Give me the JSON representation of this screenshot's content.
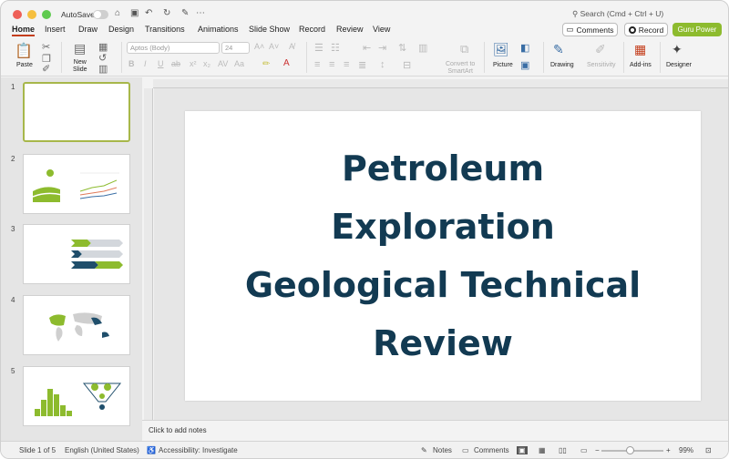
{
  "titlebar": {
    "autosave_label": "AutoSave",
    "search_placeholder": "Search (Cmd + Ctrl + U)"
  },
  "tabs": [
    {
      "label": "Home",
      "active": true
    },
    {
      "label": "Insert"
    },
    {
      "label": "Draw"
    },
    {
      "label": "Design"
    },
    {
      "label": "Transitions"
    },
    {
      "label": "Animations"
    },
    {
      "label": "Slide Show"
    },
    {
      "label": "Record"
    },
    {
      "label": "Review"
    },
    {
      "label": "View"
    }
  ],
  "actions": {
    "comments": "Comments",
    "record": "Record",
    "guru": "Guru Power"
  },
  "ribbon": {
    "paste": "Paste",
    "new_slide": "New\nSlide",
    "font_name": "Aptos (Body)",
    "font_size": "24",
    "convert_smartart": "Convert to\nSmartArt",
    "picture": "Picture",
    "drawing": "Drawing",
    "sensitivity": "Sensitivity",
    "addins": "Add-ins",
    "designer": "Designer"
  },
  "slides": [
    {
      "num": "1"
    },
    {
      "num": "2"
    },
    {
      "num": "3"
    },
    {
      "num": "4"
    },
    {
      "num": "5"
    }
  ],
  "slide": {
    "title_lines": [
      "Petroleum",
      "Exploration",
      "Geological Technical",
      "Review"
    ]
  },
  "notes": {
    "placeholder": "Click to add notes"
  },
  "status": {
    "slide_of": "Slide 1 of 5",
    "language": "English (United States)",
    "accessibility": "Accessibility: Investigate",
    "notes": "Notes",
    "comments": "Comments",
    "zoom": "99%"
  },
  "colors": {
    "title": "#123a52",
    "accent_green": "#8dbb2e",
    "tab_underline": "#c43e1c"
  }
}
